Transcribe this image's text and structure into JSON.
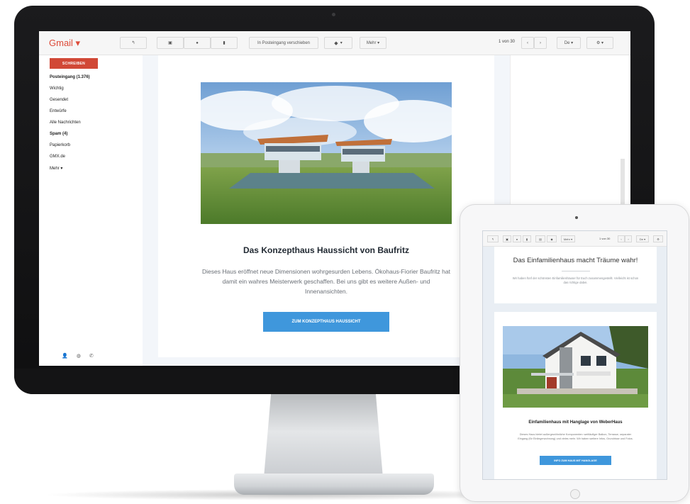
{
  "gmail": {
    "logo": "Gmail ▾",
    "toolbar": {
      "reply": "↰",
      "archive": "▣",
      "spam": "●",
      "delete": "▮",
      "move_label": "In Posteingang verschieben",
      "labels": "▾",
      "more": "Mehr ▾",
      "pager": "1 von 30",
      "prev": "‹",
      "next": "›",
      "lang": "De ▾",
      "settings": "⚙ ▾"
    },
    "sidebar": {
      "compose": "SCHREIBEN",
      "folders": [
        "Posteingang (1.376)",
        "Wichtig",
        "Gesendet",
        "Entwürfe",
        "Alle Nachrichten",
        "Spam (4)",
        "Papierkorb",
        "GMX.de",
        "Mehr ▾"
      ]
    },
    "email": {
      "title": "Das Konzepthaus Haussicht von Baufritz",
      "body": "Dieses Haus eröffnet neue Dimensionen wohrgesurden Lebens. Ökohaus-Fiorier Baufritz hat damit ein wahres Meisterwerk geschaffen. Bei uns gibt es weitere Außen- und Innenansichten.",
      "cta": "ZUM KONZEPTHAUS HAUSSICHT"
    }
  },
  "tablet": {
    "pager": "1 von 30",
    "lang": "De ▾",
    "more": "Mehr ▾",
    "headline": "Das Einfamilienhaus macht Träume wahr!",
    "intro": "Wir haben fünf der schönsten Einfamilienhäuser für Euch zusammengestellt. Vielleicht ist schon das richtige dabei.",
    "card_title": "Einfamilienhaus mit Hanglage von WeberHaus",
    "card_body": "Dieses Haus bietet außergewöhnliche Komponenten: weitläufiger Balkon, Terrasse, separater Eingang (für Einliegerwohnung) und vieles mehr. Wir haben weitere Infos, Grundrisse und Fotos.",
    "card_cta": "INFO ZUM HAUS MIT HANGLAGE"
  }
}
